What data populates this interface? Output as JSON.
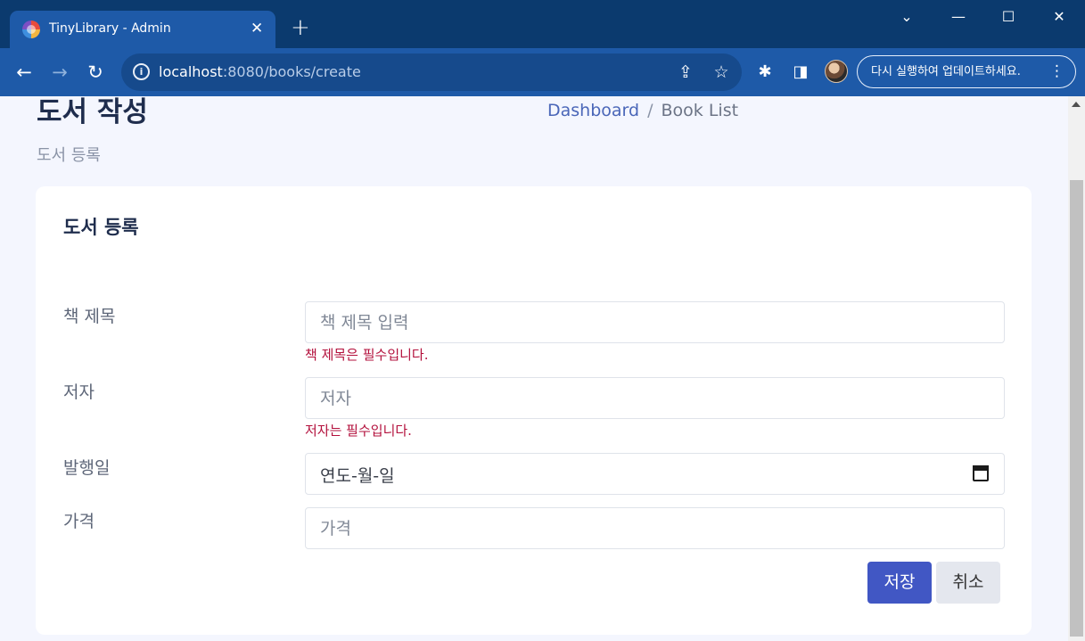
{
  "browser": {
    "tab_title": "TinyLibrary - Admin",
    "tab_close": "✕",
    "new_tab": "+",
    "window": {
      "minimize": "—",
      "maximize": "☐",
      "close": "✕",
      "tab_search": "⌄"
    },
    "nav": {
      "back": "←",
      "forward": "→",
      "reload": "↻"
    },
    "url_host": "localhost",
    "url_path": ":8080/books/create",
    "info_icon": "i",
    "share_icon": "⇪",
    "star_icon": "☆",
    "extensions_icon": "✱",
    "sidepanel_icon": "◨",
    "update_label": "다시 실행하여 업데이트하세요.",
    "menu_icon": "⋮"
  },
  "page": {
    "title": "도서 작성",
    "subtitle": "도서 등록",
    "breadcrumb": {
      "home": "Dashboard",
      "separator": "/",
      "current": "Book List"
    }
  },
  "form": {
    "card_title": "도서 등록",
    "title_field": {
      "label": "책 제목",
      "placeholder": "책 제목 입력",
      "error": "책 제목은 필수입니다."
    },
    "author_field": {
      "label": "저자",
      "placeholder": "저자",
      "error": "저자는 필수입니다."
    },
    "date_field": {
      "label": "발행일",
      "display": "연도-월-일"
    },
    "price_field": {
      "label": "가격",
      "placeholder": "가격"
    },
    "save_label": "저장",
    "cancel_label": "취소"
  },
  "colors": {
    "primary": "#4157c4",
    "error": "#b3103c",
    "chrome_dark": "#0b3a6e",
    "chrome_toolbar": "#1e5aa8"
  }
}
